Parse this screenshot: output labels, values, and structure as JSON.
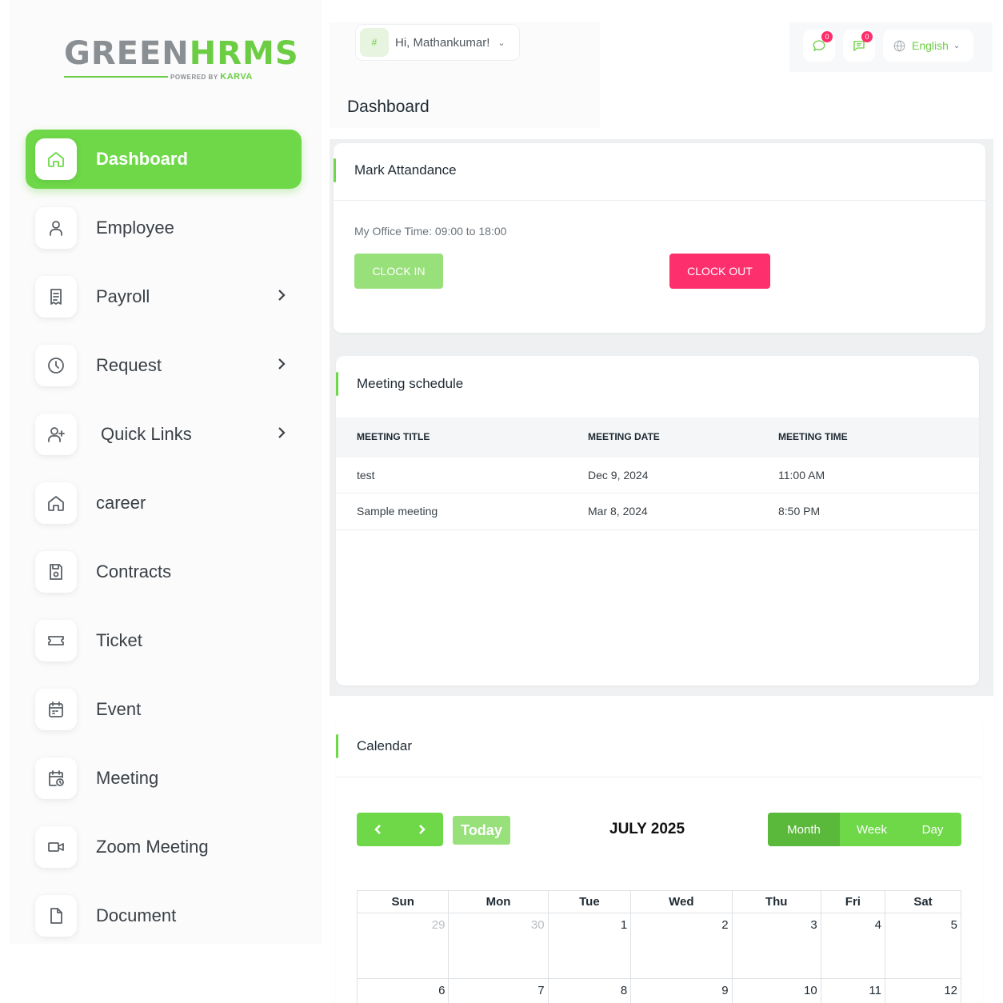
{
  "brand": {
    "word1": "GREEN",
    "word2": "HRMS",
    "powered": "POWERED BY",
    "powered_brand": "KARVA"
  },
  "header": {
    "greeting": "Hi, Mathankumar!",
    "avatar_alt": "#",
    "page_title": "Dashboard",
    "chat_count": "0",
    "message_count": "0",
    "language": "English"
  },
  "sidebar": {
    "items": [
      {
        "label": "Dashboard",
        "icon": "home-icon"
      },
      {
        "label": "Employee",
        "icon": "user-icon"
      },
      {
        "label": "Payroll",
        "icon": "receipt-icon"
      },
      {
        "label": "Request",
        "icon": "clock-icon"
      },
      {
        "label": "Quick Links",
        "icon": "user-plus-icon"
      },
      {
        "label": "career",
        "icon": "home-icon"
      },
      {
        "label": "Contracts",
        "icon": "save-icon"
      },
      {
        "label": "Ticket",
        "icon": "ticket-icon"
      },
      {
        "label": "Event",
        "icon": "calendar-icon"
      },
      {
        "label": "Meeting",
        "icon": "calendar-clock-icon"
      },
      {
        "label": "Zoom Meeting",
        "icon": "video-icon"
      },
      {
        "label": "Document",
        "icon": "file-icon"
      }
    ]
  },
  "attendance": {
    "title": "Mark Attandance",
    "office_time": "My Office Time: 09:00 to 18:00",
    "clock_in": "CLOCK IN",
    "clock_out": "CLOCK OUT"
  },
  "meetings": {
    "title": "Meeting schedule",
    "columns": [
      "MEETING TITLE",
      "MEETING DATE",
      "MEETING TIME"
    ],
    "rows": [
      [
        "test",
        "Dec 9, 2024",
        "11:00 AM"
      ],
      [
        "Sample meeting",
        "Mar 8, 2024",
        "8:50 PM"
      ]
    ]
  },
  "calendar": {
    "title": "Calendar",
    "today": "Today",
    "month_title": "JULY 2025",
    "views": [
      "Month",
      "Week",
      "Day"
    ],
    "weekdays": [
      "Sun",
      "Mon",
      "Tue",
      "Wed",
      "Thu",
      "Fri",
      "Sat"
    ],
    "week1": [
      "29",
      "30",
      "1",
      "2",
      "3",
      "4",
      "5"
    ],
    "week2": [
      "6",
      "7",
      "8",
      "9",
      "10",
      "11",
      "12"
    ]
  },
  "colors": {
    "accent": "#6ed848",
    "danger": "#fd2f6d",
    "light_accent": "#97e07a"
  }
}
